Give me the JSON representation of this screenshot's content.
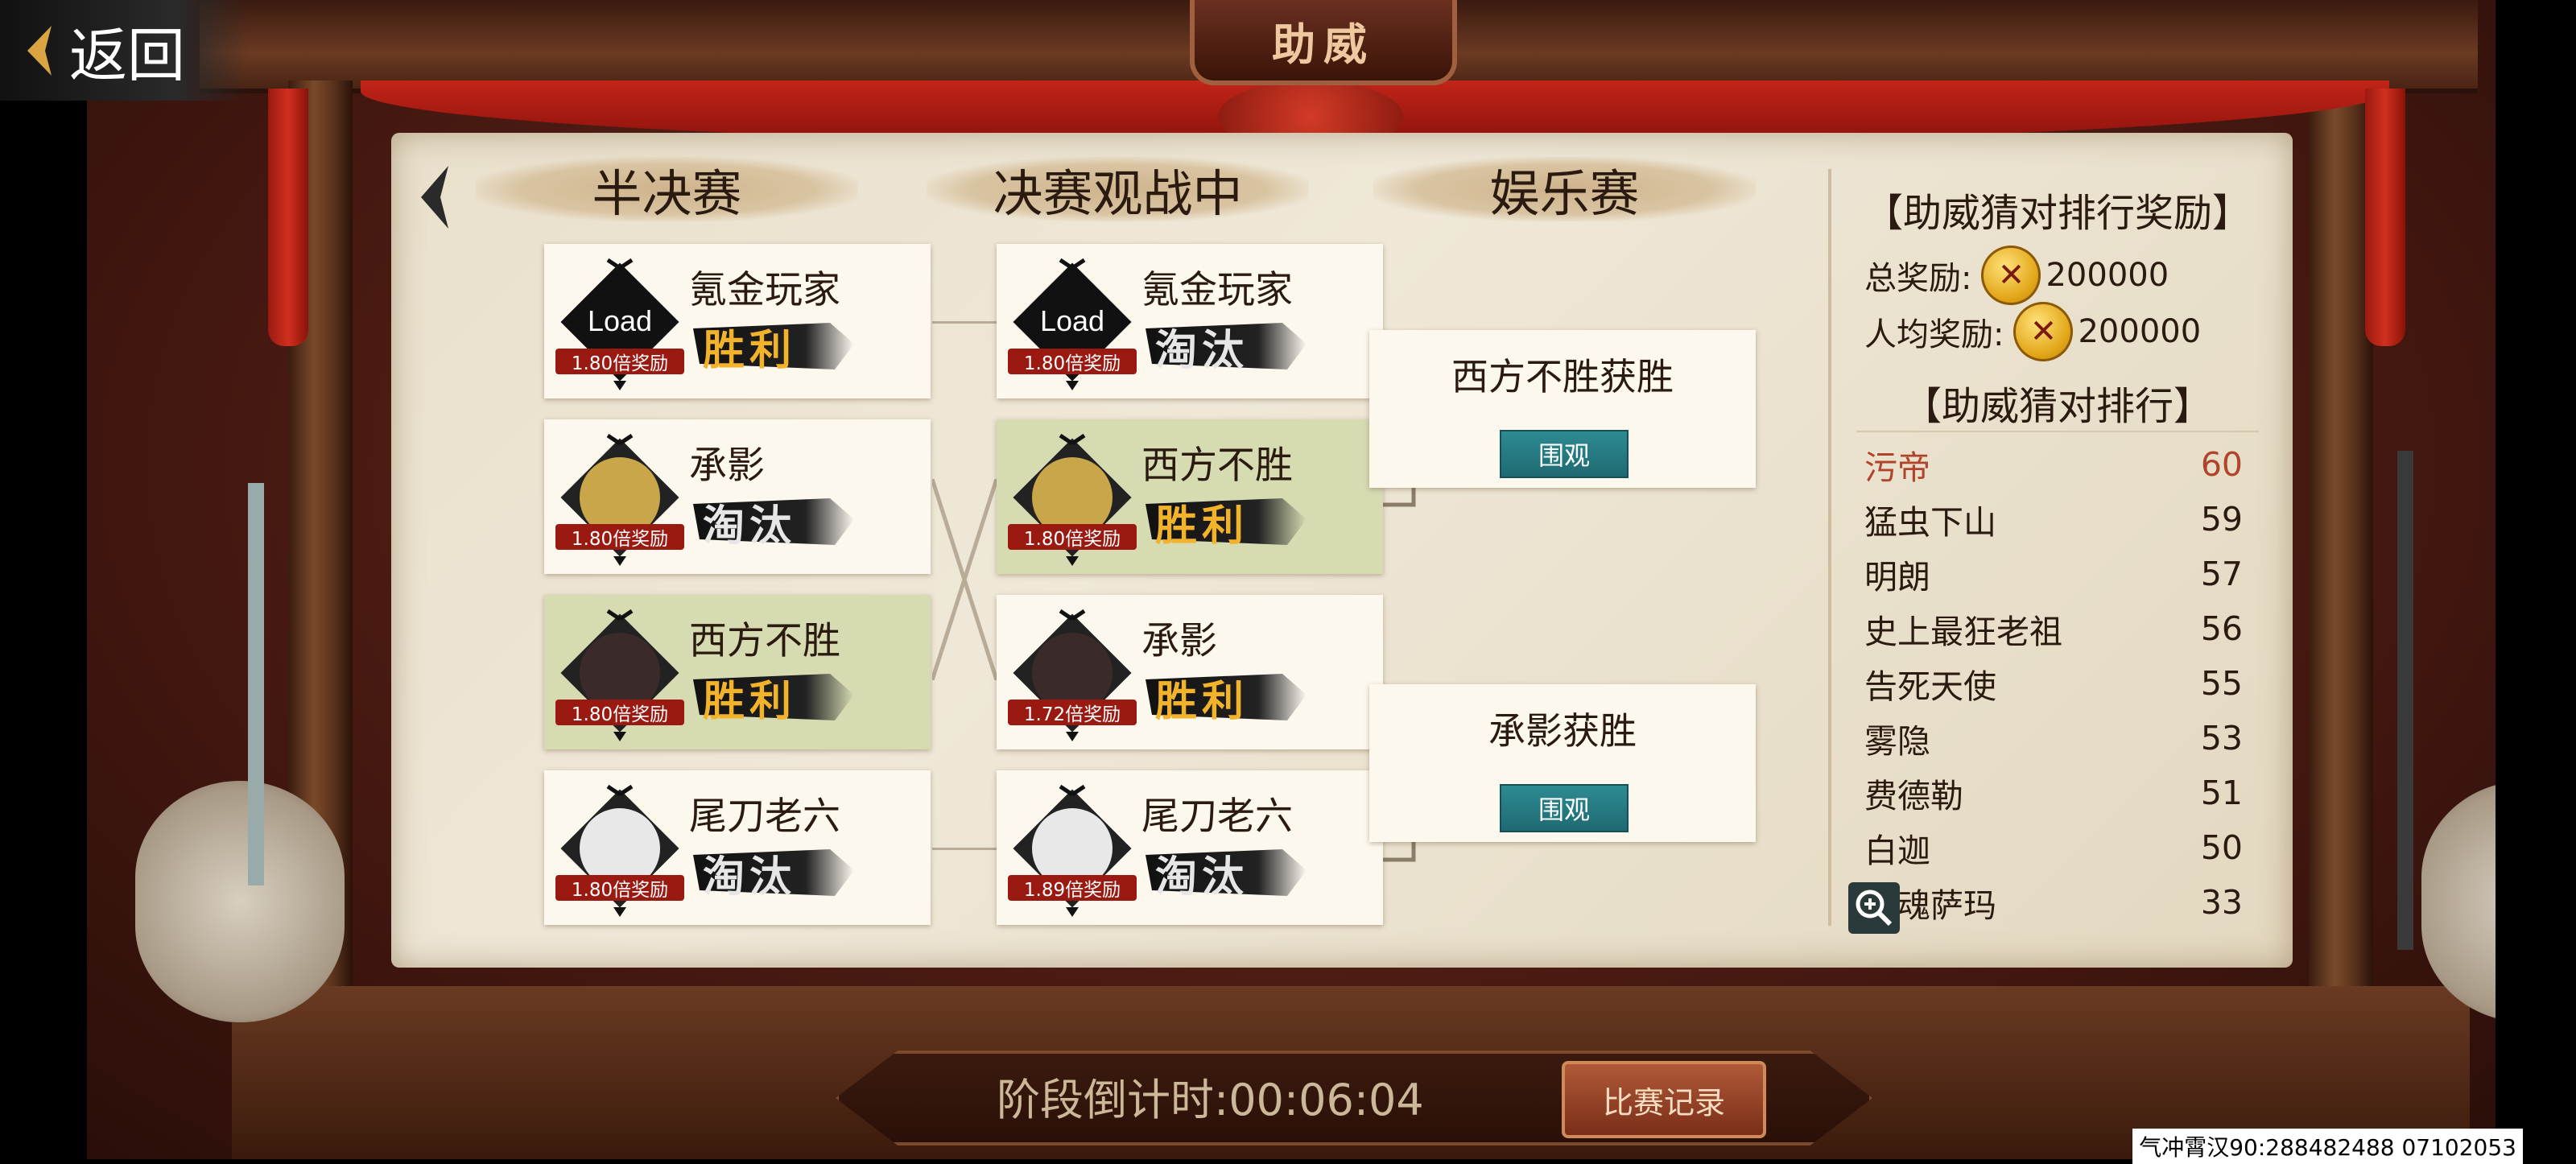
{
  "back": {
    "label": "返回"
  },
  "plaque": {
    "title": "助威"
  },
  "columns": {
    "semi": "半决赛",
    "final": "决赛观战中",
    "fun": "娱乐赛"
  },
  "semifinal": [
    {
      "name": "氪金玩家",
      "avatar_text": "Load",
      "bonus": "1.80倍奖励",
      "result": "胜利",
      "won": true,
      "highlight": false
    },
    {
      "name": "承影",
      "bonus": "1.80倍奖励",
      "result": "淘汰",
      "won": false,
      "highlight": false
    },
    {
      "name": "西方不胜",
      "bonus": "1.80倍奖励",
      "result": "胜利",
      "won": true,
      "highlight": true
    },
    {
      "name": "尾刀老六",
      "bonus": "1.80倍奖励",
      "result": "淘汰",
      "won": false,
      "highlight": false
    }
  ],
  "final": [
    {
      "name": "氪金玩家",
      "avatar_text": "Load",
      "bonus": "1.80倍奖励",
      "result": "淘汰",
      "won": false,
      "highlight": false
    },
    {
      "name": "西方不胜",
      "bonus": "1.80倍奖励",
      "result": "胜利",
      "won": true,
      "highlight": true
    },
    {
      "name": "承影",
      "bonus": "1.72倍奖励",
      "result": "胜利",
      "won": true,
      "highlight": false
    },
    {
      "name": "尾刀老六",
      "bonus": "1.89倍奖励",
      "result": "淘汰",
      "won": false,
      "highlight": false
    }
  ],
  "fun_matches": [
    {
      "title": "西方不胜获胜",
      "watch": "围观"
    },
    {
      "title": "承影获胜",
      "watch": "围观"
    }
  ],
  "rewards": {
    "title": "【助威猜对排行奖励】",
    "total_label": "总奖励:",
    "total_value": "200000",
    "avg_label": "人均奖励:",
    "avg_value": "200000"
  },
  "ranking": {
    "title": "【助威猜对排行】",
    "rows": [
      {
        "name": "污帝",
        "score": "60"
      },
      {
        "name": "猛虫下山",
        "score": "59"
      },
      {
        "name": "明朗",
        "score": "57"
      },
      {
        "name": "史上最狂老祖",
        "score": "56"
      },
      {
        "name": "告死天使",
        "score": "55"
      },
      {
        "name": "雾隐",
        "score": "53"
      },
      {
        "name": "费德勒",
        "score": "51"
      },
      {
        "name": "白迦",
        "score": "50"
      },
      {
        "name": "星魂萨玛",
        "score": "33"
      }
    ]
  },
  "countdown": {
    "label": "阶段倒计时:",
    "time": "00:06:04"
  },
  "record_button": "比赛记录",
  "footer_id": "气冲霄汉90:288482488  07102053",
  "icons": {
    "back": "chevron-left-icon",
    "coin": "copper-coin-icon",
    "zoom": "zoom-in-icon"
  },
  "colors": {
    "accent_red": "#9a1a12",
    "win_gold": "#f2b22a",
    "watch_teal": "#1f6a72",
    "highlight_green": "#d6dbb2"
  }
}
